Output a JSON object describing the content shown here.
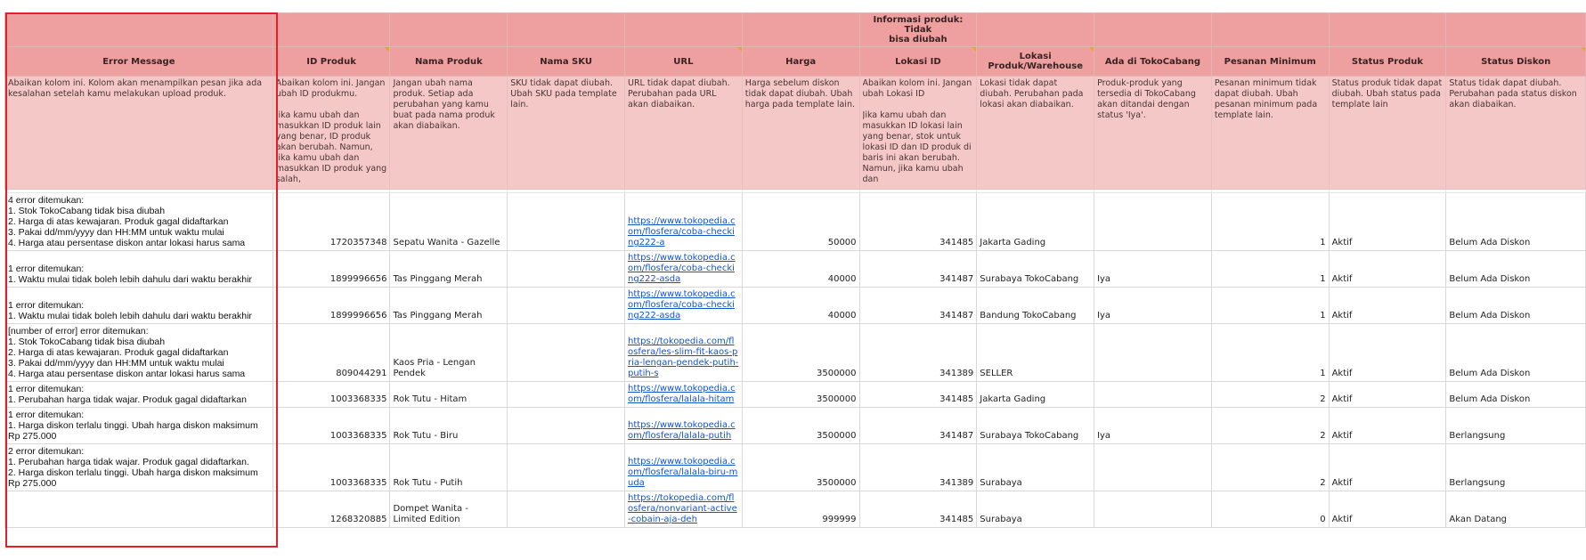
{
  "group_header": "Informasi produk: Tidak\nbisa diubah",
  "columns": [
    {
      "label": "Error Message",
      "desc": "Abaikan kolom ini. Kolom akan menampilkan pesan jika ada kesalahan setelah kamu melakukan upload produk."
    },
    {
      "label": "ID Produk",
      "desc": "Abaikan kolom ini. Jangan ubah ID produkmu.\n\nJika kamu ubah dan masukkan ID produk lain yang benar, ID produk akan berubah. Namun, jika kamu ubah dan masukkan ID produk yang salah,"
    },
    {
      "label": "Nama Produk",
      "desc": "Jangan ubah nama produk. Setiap ada perubahan yang kamu buat pada nama produk akan diabaikan."
    },
    {
      "label": "Nama SKU",
      "desc": "SKU tidak dapat diubah. Ubah SKU pada template lain."
    },
    {
      "label": "URL",
      "desc": "URL tidak dapat diubah. Perubahan pada URL akan diabaikan."
    },
    {
      "label": "Harga",
      "desc": "Harga sebelum diskon tidak dapat diubah. Ubah harga pada template lain."
    },
    {
      "label": "Lokasi ID",
      "desc": "Abaikan kolom ini. Jangan ubah Lokasi ID\n\nJika kamu ubah dan masukkan ID lokasi lain yang benar, stok untuk lokasi ID dan ID produk di baris ini akan berubah. Namun, jika kamu ubah dan"
    },
    {
      "label": "Lokasi Produk/Warehouse",
      "desc": "Lokasi tidak dapat diubah. Perubahan pada lokasi akan diabaikan."
    },
    {
      "label": "Ada di TokoCabang",
      "desc": "Produk-produk yang tersedia di TokoCabang akan ditandai dengan status 'Iya'."
    },
    {
      "label": "Pesanan Minimum",
      "desc": "Pesanan minimum tidak dapat diubah. Ubah pesanan minimum pada template lain."
    },
    {
      "label": "Status Produk",
      "desc": "Status produk tidak dapat diubah. Ubah status pada template lain"
    },
    {
      "label": "Status Diskon",
      "desc": "Status tidak dapat diubah. Perubahan pada status diskon akan diabaikan."
    }
  ],
  "rows": [
    {
      "error": "4 error ditemukan:\n1. Stok TokoCabang tidak bisa diubah\n2. Harga di atas kewajaran. Produk gagal didaftarkan\n3. Pakai dd/mm/yyyy dan HH:MM untuk waktu mulai\n4. Harga atau persentase diskon antar lokasi harus sama",
      "id": "1720357348",
      "name": "Sepatu Wanita - Gazelle",
      "sku": "",
      "url": "https://www.tokopedia.com/flosfera/coba-checking222-a",
      "price": "50000",
      "loc_id": "341485",
      "location": "Jakarta Gading",
      "cabang": "",
      "min": "1",
      "status": "Aktif",
      "discount": "Belum Ada Diskon"
    },
    {
      "error": "1 error ditemukan:\n1. Waktu mulai tidak boleh lebih dahulu dari waktu berakhir",
      "id": "1899996656",
      "name": "Tas Pinggang Merah",
      "sku": "",
      "url": "https://www.tokopedia.com/flosfera/coba-checking222-asda",
      "price": "40000",
      "loc_id": "341487",
      "location": "Surabaya TokoCabang",
      "cabang": "Iya",
      "min": "1",
      "status": "Aktif",
      "discount": "Belum Ada Diskon"
    },
    {
      "error": "1 error ditemukan:\n1. Waktu mulai tidak boleh lebih dahulu dari waktu berakhir",
      "id": "1899996656",
      "name": "Tas Pinggang Merah",
      "sku": "",
      "url": "https://www.tokopedia.com/flosfera/coba-checking222-asda",
      "price": "40000",
      "loc_id": "341487",
      "location": "Bandung TokoCabang",
      "cabang": "Iya",
      "min": "1",
      "status": "Aktif",
      "discount": "Belum Ada Diskon"
    },
    {
      "error": "[number of error] error ditemukan:\n1. Stok TokoCabang tidak bisa diubah\n2. Harga di atas kewajaran. Produk gagal didaftarkan\n3. Pakai dd/mm/yyyy dan HH:MM untuk waktu mulai\n4. Harga atau persentase diskon antar lokasi harus sama",
      "id": "809044291",
      "name": "Kaos Pria - Lengan Pendek",
      "sku": "",
      "url": "https://tokopedia.com/flosfera/les-slim-fit-kaos-pria-lengan-pendek-putih-putih-s",
      "price": "3500000",
      "loc_id": "341389",
      "location": "SELLER",
      "cabang": "",
      "min": "1",
      "status": "Aktif",
      "discount": "Belum Ada Diskon"
    },
    {
      "error": "1 error ditemukan:\n1. Perubahan harga tidak wajar. Produk gagal didaftarkan",
      "id": "1003368335",
      "name": "Rok Tutu - Hitam",
      "sku": "",
      "url": "https://www.tokopedia.com/flosfera/lalala-hitam",
      "price": "3500000",
      "loc_id": "341485",
      "location": "Jakarta Gading",
      "cabang": "",
      "min": "2",
      "status": "Aktif",
      "discount": "Belum Ada Diskon"
    },
    {
      "error": "1 error ditemukan:\n1. Harga diskon terlalu tinggi. Ubah harga diskon maksimum Rp 275.000",
      "id": "1003368335",
      "name": "Rok Tutu - Biru",
      "sku": "",
      "url": "https://www.tokopedia.com/flosfera/lalala-putih",
      "price": "3500000",
      "loc_id": "341487",
      "location": "Surabaya TokoCabang",
      "cabang": "Iya",
      "min": "2",
      "status": "Aktif",
      "discount": "Berlangsung"
    },
    {
      "error": "2 error ditemukan:\n1. Perubahan harga tidak wajar. Produk gagal didaftarkan.\n2. Harga diskon terlalu tinggi. Ubah harga diskon maksimum Rp 275.000",
      "id": "1003368335",
      "name": "Rok Tutu - Putih",
      "sku": "",
      "url": "https://www.tokopedia.com/flosfera/lalala-biru-muda",
      "price": "3500000",
      "loc_id": "341389",
      "location": "Surabaya",
      "cabang": "",
      "min": "2",
      "status": "Aktif",
      "discount": "Berlangsung"
    },
    {
      "error": "",
      "id": "1268320885",
      "name": "Dompet Wanita - Limited Edition",
      "sku": "",
      "url": "https://tokopedia.com/flosfera/nonvariant-active-cobain-aja-deh",
      "price": "999999",
      "loc_id": "341485",
      "location": "Surabaya",
      "cabang": "",
      "min": "0",
      "status": "Aktif",
      "discount": "Akan Datang"
    }
  ],
  "colors": {
    "header": "#eea0a0",
    "desc": "#f5c8c8",
    "link": "#1155cc",
    "selection": "#e0202a"
  }
}
